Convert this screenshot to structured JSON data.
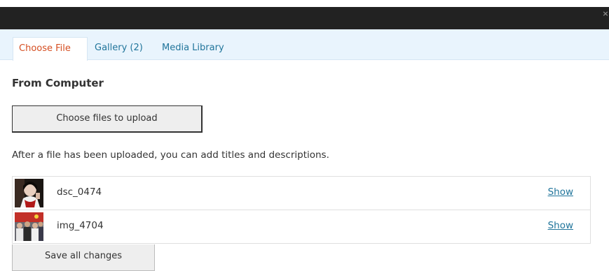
{
  "window": {
    "close_icon": "close-icon",
    "close_glyph": "×"
  },
  "tabs": [
    {
      "label": "Choose File",
      "active": true
    },
    {
      "label": "Gallery (2)",
      "active": false
    },
    {
      "label": "Media Library",
      "active": false
    }
  ],
  "upload": {
    "section_title": "From Computer",
    "choose_button_label": "Choose files to upload",
    "help_text": "After a file has been uploaded, you can add titles and descriptions."
  },
  "files": [
    {
      "name": "dsc_0474",
      "action_label": "Show",
      "thumbnail": "portrait-photo-thumbnail"
    },
    {
      "name": "img_4704",
      "action_label": "Show",
      "thumbnail": "group-photo-thumbnail"
    }
  ],
  "footer": {
    "save_button_label": "Save all changes"
  },
  "colors": {
    "titlebar": "#222222",
    "tabbar": "#e9f4fd",
    "link": "#21759b",
    "active_tab": "#d54e21"
  }
}
